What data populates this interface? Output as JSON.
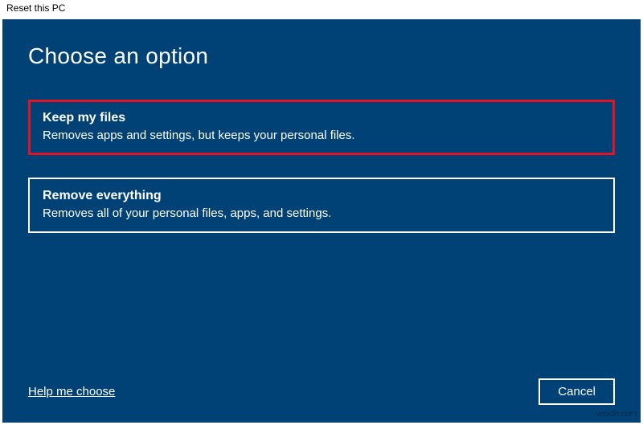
{
  "window": {
    "title": "Reset this PC"
  },
  "page": {
    "heading": "Choose an option"
  },
  "options": {
    "keep": {
      "title": "Keep my files",
      "desc": "Removes apps and settings, but keeps your personal files."
    },
    "remove": {
      "title": "Remove everything",
      "desc": "Removes all of your personal files, apps, and settings."
    }
  },
  "footer": {
    "help_label": "Help me choose",
    "cancel_label": "Cancel"
  },
  "watermark": "wsxdn.com"
}
